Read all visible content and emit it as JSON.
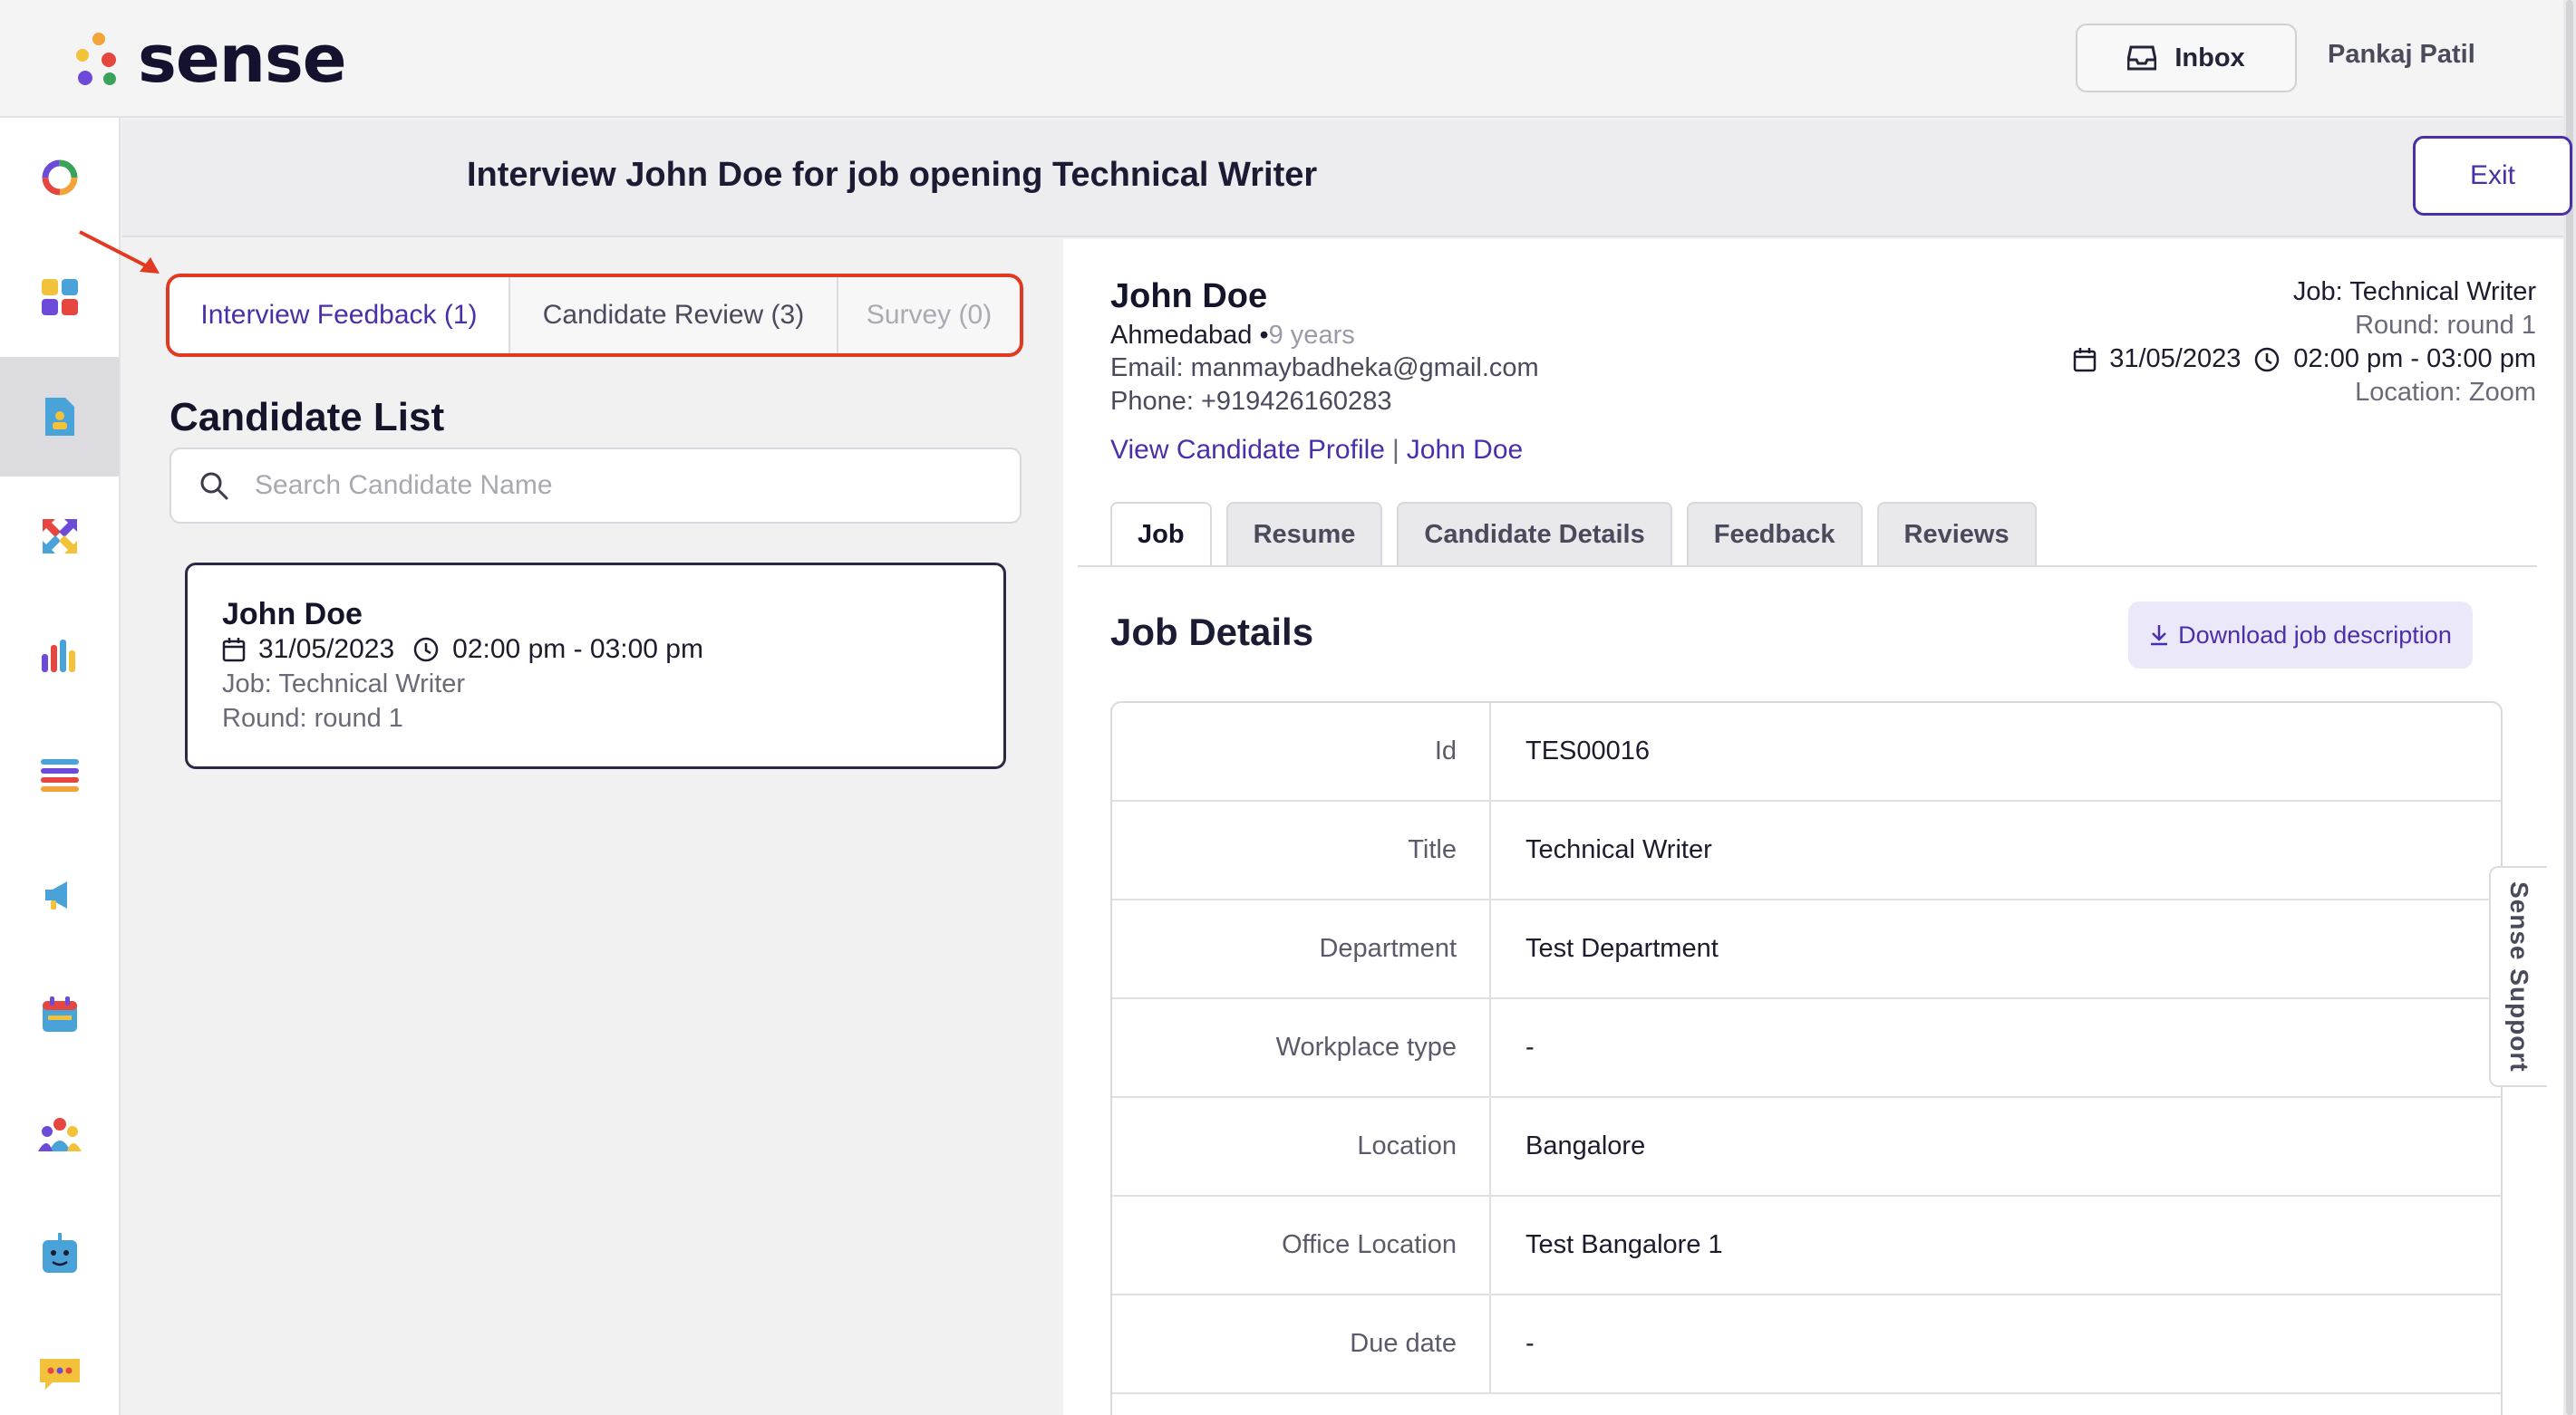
{
  "app": {
    "logo_text": "sense",
    "user_name": "Pankaj Patil",
    "inbox_label": "Inbox"
  },
  "header": {
    "title": "Interview John Doe for job opening Technical Writer",
    "exit_label": "Exit"
  },
  "left_tabs": [
    {
      "label": "Interview Feedback (1)"
    },
    {
      "label": "Candidate Review (3)"
    },
    {
      "label": "Survey (0)"
    }
  ],
  "candidate_list": {
    "title": "Candidate List",
    "search_placeholder": "Search Candidate Name",
    "items": [
      {
        "name": "John Doe",
        "date": "31/05/2023",
        "time": "02:00 pm - 03:00 pm",
        "job": "Job: Technical Writer",
        "round": "Round: round 1"
      }
    ]
  },
  "candidate": {
    "name": "John Doe",
    "city": "Ahmedabad",
    "separator": " •",
    "experience": "9 years",
    "email": "Email: manmaybadheka@gmail.com",
    "phone": "Phone: +919426160283",
    "view_profile": "View Candidate Profile",
    "link_sep": "|",
    "name_link": "John Doe"
  },
  "job_info": {
    "job": "Job: Technical Writer",
    "round": "Round: round 1",
    "date": "31/05/2023",
    "time": "02:00 pm - 03:00 pm",
    "location": "Location: Zoom"
  },
  "right_tabs": [
    {
      "label": "Job"
    },
    {
      "label": "Resume"
    },
    {
      "label": "Candidate Details"
    },
    {
      "label": "Feedback"
    },
    {
      "label": "Reviews"
    }
  ],
  "job_details": {
    "title": "Job Details",
    "download_label": "Download job description",
    "rows": [
      {
        "label": "Id",
        "value": "TES00016"
      },
      {
        "label": "Title",
        "value": "Technical Writer"
      },
      {
        "label": "Department",
        "value": "Test Department"
      },
      {
        "label": "Workplace type",
        "value": "-"
      },
      {
        "label": "Location",
        "value": "Bangalore"
      },
      {
        "label": "Office Location",
        "value": "Test Bangalore 1"
      },
      {
        "label": "Due date",
        "value": "-"
      }
    ]
  },
  "support": {
    "label": "Sense Support"
  },
  "colors": {
    "accent": "#4b2fa8",
    "highlight_border": "#e23a22"
  }
}
